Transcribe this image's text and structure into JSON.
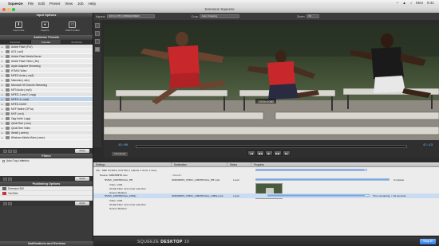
{
  "menubar": {
    "items": [
      "Squeeze",
      "File",
      "Edit",
      "Preset",
      "View",
      "Job",
      "Help"
    ],
    "right": [
      "⌁",
      "▲",
      "♪",
      "Mon",
      "9:41"
    ]
  },
  "window": {
    "title": "Sorenson Squeeze"
  },
  "left": {
    "input_options_title": "Input Options",
    "input_buttons": [
      "Import File",
      "Capture",
      "Watch Folder"
    ],
    "presets_title": "Audience Presets",
    "preset_tabs": [
      "Favorites",
      "Formats",
      "Workflows"
    ],
    "presets": [
      "Adobe Flash (FLV)",
      "AC3 (.ac3)",
      "Adobe Flash Media Server",
      "Adobe Flash Video (.f4v)",
      "Apple Adaptive Streaming",
      "HTML5 Video",
      "MPEG Audio (.mp3)",
      "Matroska (.mkv)",
      "Microsoft IIS Smooth Streaming",
      "MP3 Audio (.mp3)",
      "MPEG-1 and 2 (.mpg)",
      "MPEG-4 (.mp4)",
      "MPEG-DASH",
      "MXF Native (OP1a)",
      "MXF (.mxf)",
      "Ogg Audio (.ogg)",
      "QuickTime (.mov)",
      "QuickTime Video",
      "WebM (.webm)",
      "Windows Media Video (.wmv)"
    ],
    "apply_label": "Apply",
    "filters_title": "Filters",
    "filters": [
      "Auto Crop Letterbox"
    ],
    "publishing_title": "Publishing Options",
    "publishing": [
      "Sorenson 360",
      "YouTube"
    ],
    "notifications_title": "Notifications and Reviews"
  },
  "topbar": {
    "aspect_label": "Aspect",
    "aspect_value": "16:9 (1.78:1) WIDESCREEN",
    "crop_label": "Crop",
    "crop_value": "Auto Cropping",
    "zoom_label": "Zoom",
    "zoom_value": "Fit"
  },
  "video": {
    "resolution_overlay": "1920x1080"
  },
  "transport": {
    "in_time": "15:00",
    "out_time": "47:13",
    "thumbnail_label": "Thumbnail",
    "controls": [
      "|◀",
      "◀◀",
      "▶",
      "▶▶",
      "▶|"
    ]
  },
  "jobs": {
    "columns": [
      "Settings",
      "Destination",
      "Status",
      "Progress"
    ],
    "job_title": "Job - SEP. 04 2014, 9:41 PM, 2 outputs, 1 done, 1 busy",
    "source": "Source: SMD380HD.mov",
    "output1": {
      "name": "HMSC_1080HDClips_HB",
      "dest": "SMD380HD_HMSC_1080HDClips_HB.mp4",
      "status": "Local",
      "details": [
        "Video: x264",
        "Global Filter: Auto Crop Letterbox",
        "Source Markers"
      ],
      "progress_text": "Complete",
      "progress": 1.0
    },
    "output2": {
      "name": "HMSC_1080HDClips_1080p",
      "dest": "SMD380HD_HMSC_1080HDClips_1080p.mp4",
      "status": "Local",
      "details": [
        "Video: x264",
        "Global Filter: Auto Crop Letterbox",
        "Source Markers"
      ],
      "progress_text": "Time remaining: < 10 seconds",
      "progress": 0.96
    },
    "destination_placeholder": "<default>"
  },
  "footer": {
    "brand_a": "SQUEEZE",
    "brand_b": "DESKTOP",
    "brand_c": "10",
    "stop_label": "Stop It!"
  }
}
